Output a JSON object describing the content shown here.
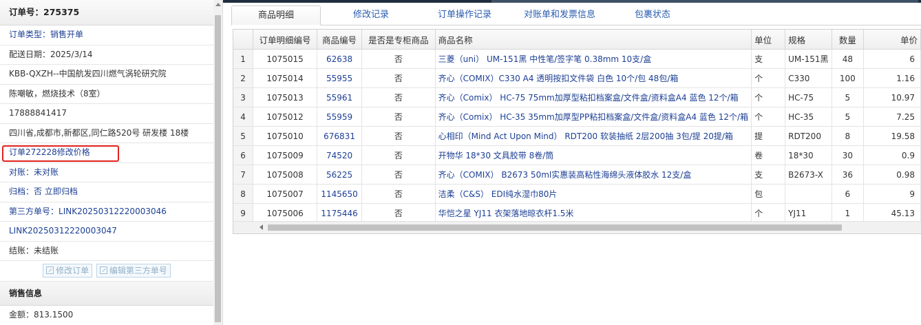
{
  "left": {
    "order_no_label": "订单号：",
    "order_no": "275375",
    "rows": [
      {
        "text": "订单类型：销售开单",
        "blue": true
      },
      {
        "text": "配送日期：2025/3/14",
        "blue": false
      },
      {
        "text": "KBB-QXZH--中国航发四川燃气涡轮研究院",
        "blue": false
      },
      {
        "text": "陈嘲敏，燃烧技术（8室）",
        "blue": false
      },
      {
        "text": "17888841417",
        "blue": false
      },
      {
        "text": "四川省,成都市,新都区,同仁路520号 研发楼 18楼",
        "blue": false
      }
    ],
    "highlight_row": "订单272228修改价格",
    "recon_label": "对账：",
    "recon_value": "未对账",
    "archive_label": "归档：",
    "archive_value": "否 立即归档",
    "third_party_label": "第三方单号：",
    "third_party_1": "LINK20250312220003046",
    "third_party_2": "LINK20250312220003047",
    "settle_label": "结账：",
    "settle_value": "未结账",
    "btn_edit_order": "修改订单",
    "btn_edit_third": "编辑第三方单号",
    "sales_title": "销售信息",
    "amount_label": "金额：",
    "amount_value": "813.1500"
  },
  "tabs": [
    "商品明细",
    "修改记录",
    "订单操作记录",
    "对账单和发票信息",
    "包裹状态"
  ],
  "table": {
    "headers": [
      "",
      "订单明细编号",
      "商品编号",
      "是否是专柜商品",
      "商品名称",
      "单位",
      "规格",
      "数量",
      "单价"
    ],
    "rows": [
      [
        "1",
        "1075015",
        "62638",
        "否",
        "三菱（uni） UM-151黑 中性笔/签字笔 0.38mm 10支/盒",
        "支",
        "UM-151黑",
        "48",
        "6"
      ],
      [
        "2",
        "1075014",
        "55955",
        "否",
        "齐心（COMIX）C330 A4 透明按扣文件袋 白色 10个/包 48包/箱",
        "个",
        "C330",
        "100",
        "1.16"
      ],
      [
        "3",
        "1075013",
        "55961",
        "否",
        "齐心（Comix） HC-75 75mm加厚型粘扣档案盒/文件盒/资料盒A4 蓝色 12个/箱",
        "个",
        "HC-75",
        "5",
        "10.97"
      ],
      [
        "4",
        "1075012",
        "55959",
        "否",
        "齐心（Comix） HC-35 35mm加厚型PP粘扣档案盒/文件盒/资料盒A4 蓝色 12个/箱",
        "个",
        "HC-35",
        "5",
        "7.25"
      ],
      [
        "5",
        "1075010",
        "676831",
        "否",
        "心相印（Mind Act Upon Mind） RDT200 软装抽纸 2层200抽 3包/提 20提/箱",
        "提",
        "RDT200",
        "8",
        "19.58"
      ],
      [
        "6",
        "1075009",
        "74520",
        "否",
        "开物华 18*30 文具胶带 8卷/筒",
        "卷",
        "18*30",
        "30",
        "0.9"
      ],
      [
        "7",
        "1075008",
        "56225",
        "否",
        "齐心（COMIX） B2673 50ml实惠装高粘性海绵头液体胶水 12支/盒",
        "支",
        "B2673-X",
        "36",
        "0.98"
      ],
      [
        "8",
        "1075007",
        "1145650",
        "否",
        "洁柔（C&S） EDI纯水湿巾80片",
        "包",
        "",
        "6",
        "9"
      ],
      [
        "9",
        "1075006",
        "1175446",
        "否",
        "华恺之星 YJ11 衣架落地晾衣杆1.5米",
        "个",
        "YJ11",
        "1",
        "45.13"
      ]
    ]
  }
}
